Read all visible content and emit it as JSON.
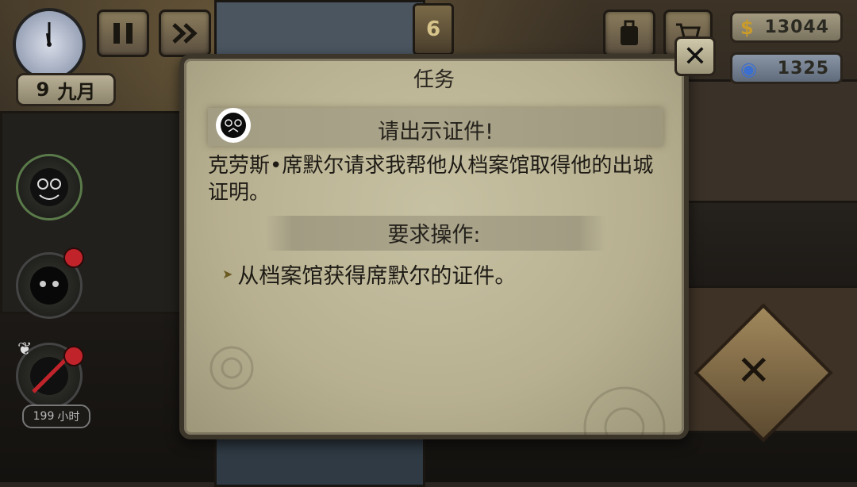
{
  "hud": {
    "date_day": "9",
    "date_month": "九月",
    "floor_number": "6",
    "money": "13044",
    "tokens": "1325",
    "money_symbol": "$"
  },
  "tenants": [
    {
      "name": "tenant-1",
      "alert": false
    },
    {
      "name": "tenant-2",
      "alert": true
    },
    {
      "name": "tenant-3",
      "alert": true,
      "hours": "199",
      "hours_unit": "小时"
    }
  ],
  "modal": {
    "title": "任务",
    "quest_title": "请出示证件!",
    "description": "克劳斯•席默尔请求我帮他从档案馆取得他的出城证明。",
    "requirement_header": "要求操作:",
    "requirements": [
      "从档案馆获得席默尔的证件。"
    ]
  },
  "colors": {
    "parchment": "#b7b090",
    "ink": "#1d1a15",
    "alert": "#c0242a"
  }
}
